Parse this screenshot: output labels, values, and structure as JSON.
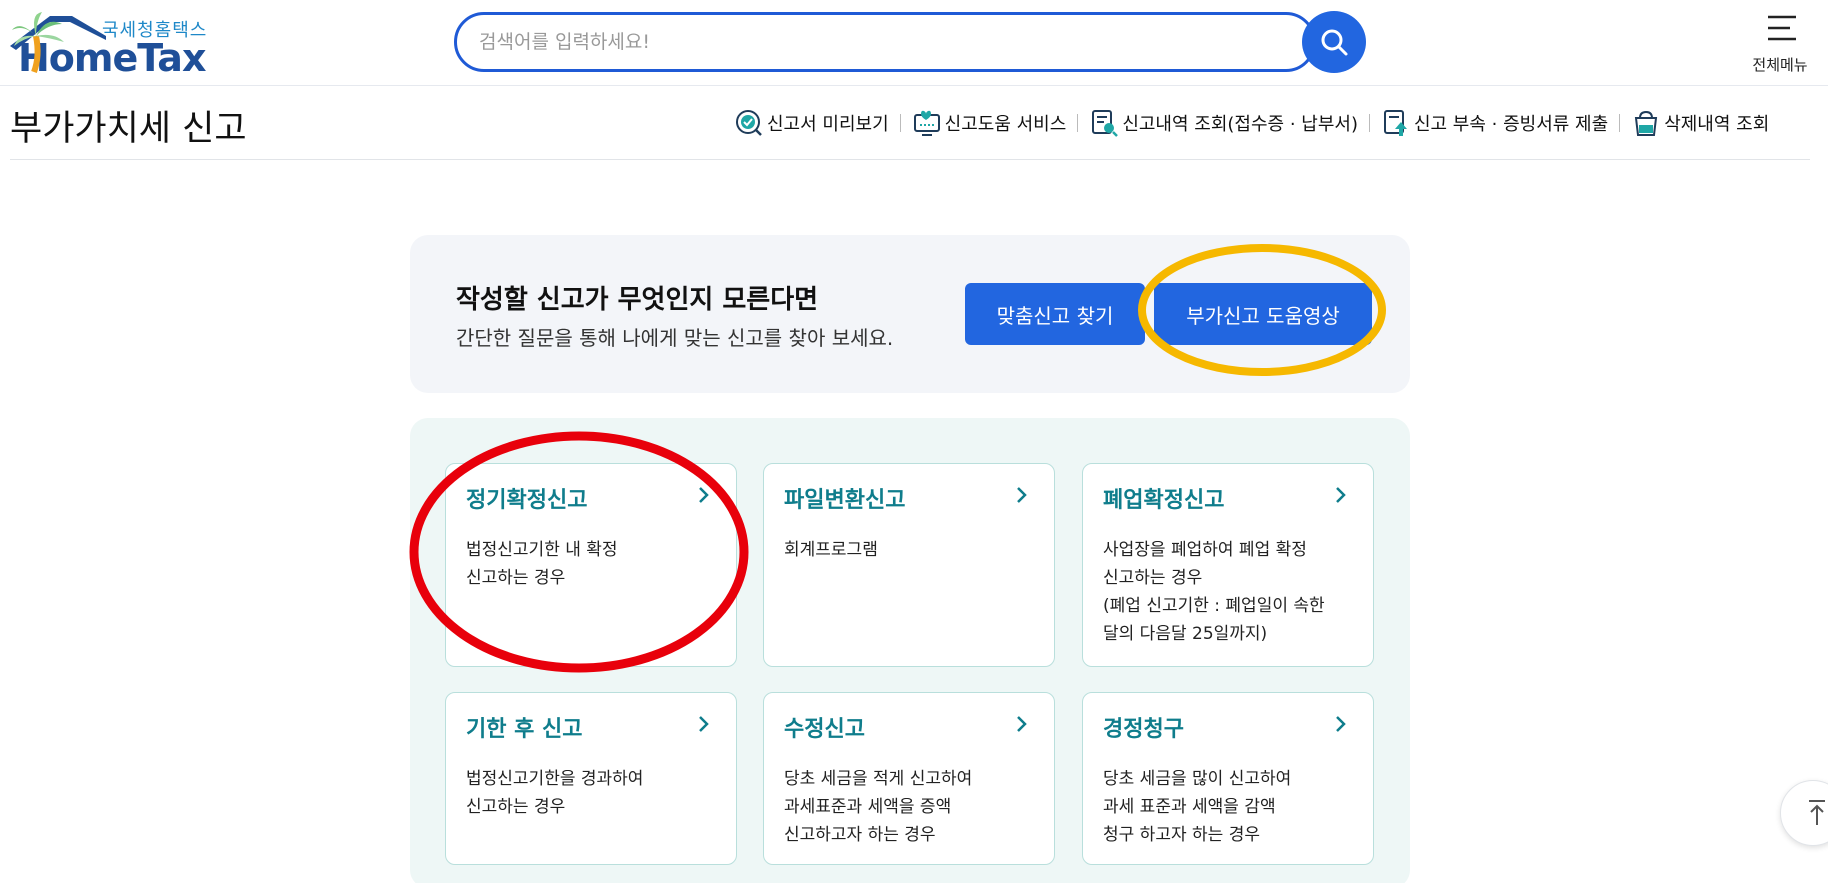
{
  "header": {
    "logo_sub": "국세청홈택스",
    "logo_main": "HomeTax",
    "search_placeholder": "검색어를 입력하세요!",
    "menu_label": "전체메뉴"
  },
  "page": {
    "title": "부가가치세 신고"
  },
  "quick_links": [
    {
      "label": "신고서 미리보기",
      "icon": "check-search-icon"
    },
    {
      "label": "신고도움 서비스",
      "icon": "monitor-heart-icon"
    },
    {
      "label": "신고내역 조회(접수증 · 납부서)",
      "icon": "document-search-icon"
    },
    {
      "label": "신고 부속 · 증빙서류 제출",
      "icon": "document-upload-icon"
    },
    {
      "label": "삭제내역 조회",
      "icon": "trash-basket-icon"
    }
  ],
  "help": {
    "title": "작성할 신고가 무엇인지 모른다면",
    "subtitle": "간단한 질문을 통해 나에게 맞는 신고를 찾아 보세요.",
    "btn_custom": "맞춤신고 찾기",
    "btn_video": "부가신고 도움영상"
  },
  "cards": [
    {
      "title": "정기확정신고",
      "desc": [
        "법정신고기한 내 확정",
        "신고하는 경우"
      ]
    },
    {
      "title": "파일변환신고",
      "desc": [
        "회계프로그램"
      ]
    },
    {
      "title": "폐업확정신고",
      "desc": [
        "사업장을 폐업하여 폐업 확정",
        "신고하는 경우",
        "(폐업 신고기한 : 폐업일이 속한",
        "달의 다음달 25일까지)"
      ]
    },
    {
      "title": "기한 후 신고",
      "desc": [
        "법정신고기한을 경과하여",
        "신고하는 경우"
      ]
    },
    {
      "title": "수정신고",
      "desc": [
        "당초 세금을 적게 신고하여",
        "과세표준과 세액을 증액",
        "신고하고자 하는 경우"
      ]
    },
    {
      "title": "경정청구",
      "desc": [
        "당초 세금을 많이 신고하여",
        "과세 표준과 세액을 감액",
        "청구 하고자 하는 경우"
      ]
    }
  ],
  "colors": {
    "brand_blue": "#2266e0",
    "card_title_teal": "#0f7d8c",
    "annotation_red": "#e8000b",
    "annotation_yellow": "#f6b800"
  }
}
